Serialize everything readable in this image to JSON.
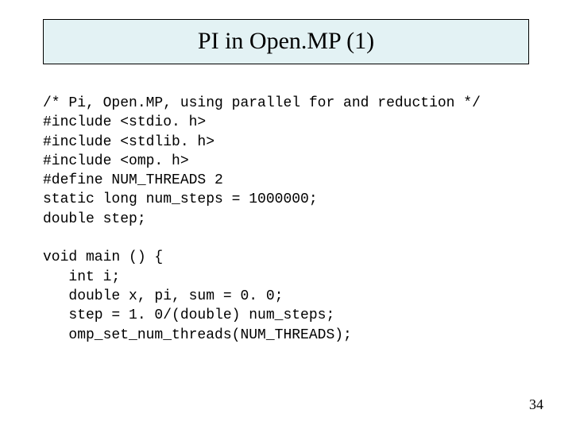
{
  "title": "PI in Open.MP (1)",
  "code": "/* Pi, Open.MP, using parallel for and reduction */\n#include <stdio. h>\n#include <stdlib. h>\n#include <omp. h>\n#define NUM_THREADS 2\nstatic long num_steps = 1000000;\ndouble step;\n\nvoid main () {\n   int i;\n   double x, pi, sum = 0. 0;\n   step = 1. 0/(double) num_steps;\n   omp_set_num_threads(NUM_THREADS);",
  "page_number": "34"
}
